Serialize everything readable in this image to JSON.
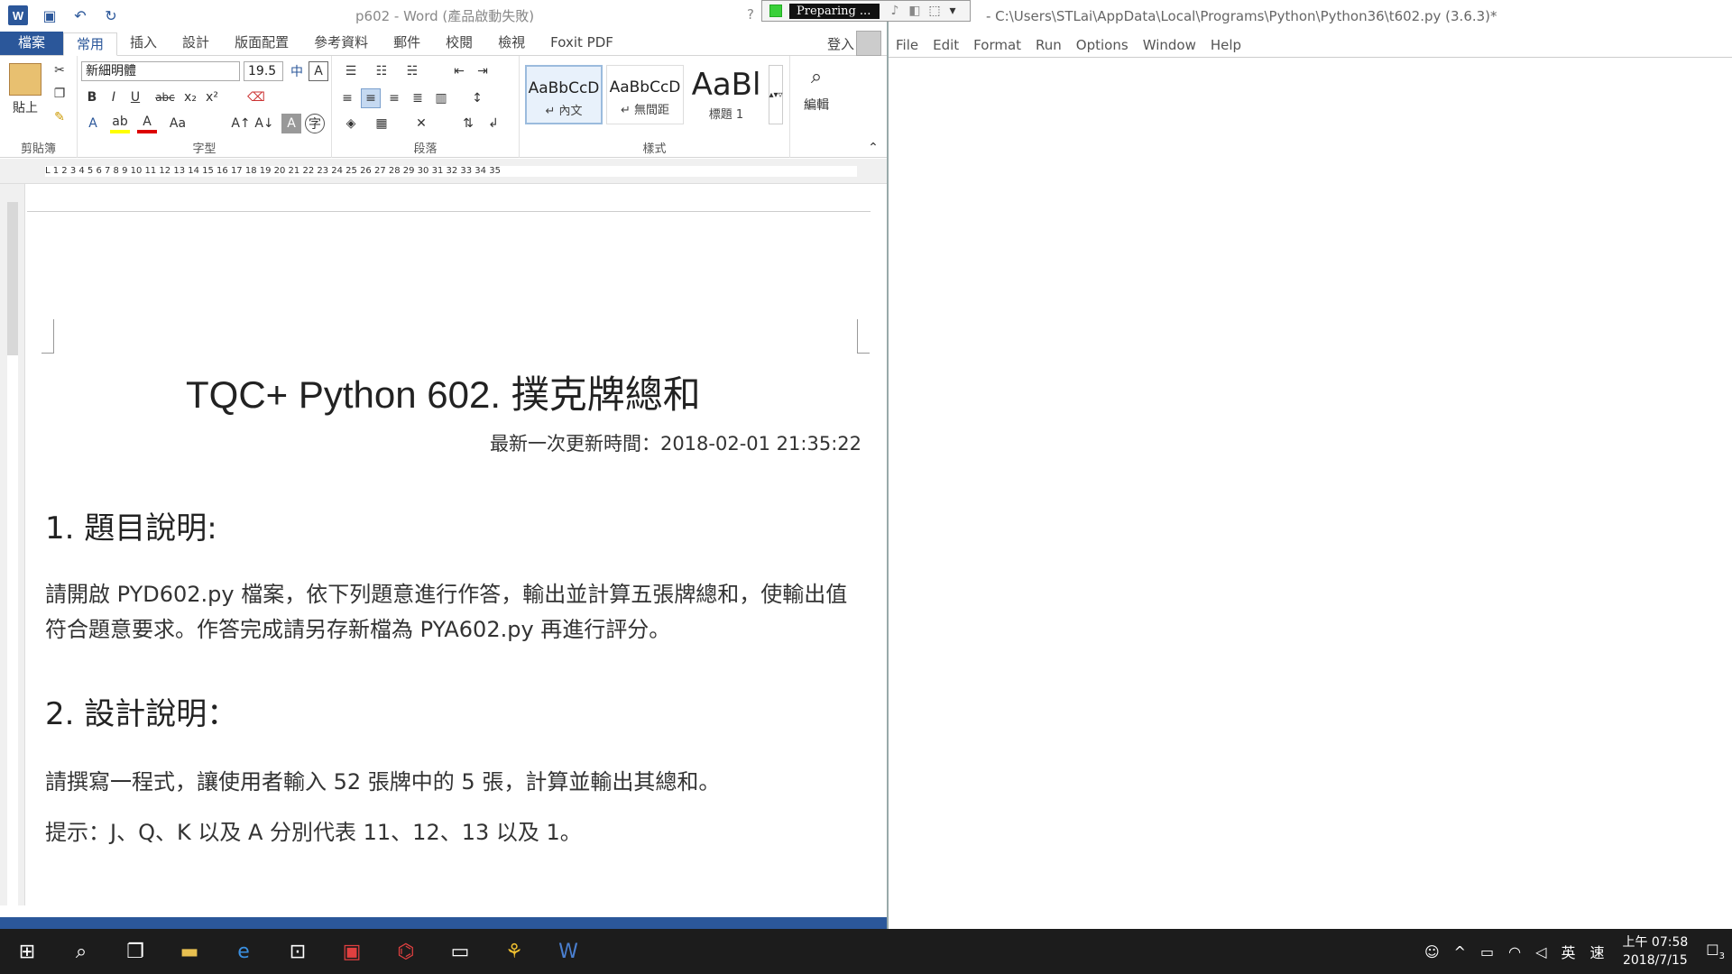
{
  "qat": {
    "title": "p602 - Word (產品啟動失敗)",
    "help": "?"
  },
  "tabs": [
    "檔案",
    "常用",
    "插入",
    "設計",
    "版面配置",
    "參考資料",
    "郵件",
    "校閱",
    "檢視",
    "Foxit PDF"
  ],
  "signin": "登入",
  "ribbon": {
    "clipboard": {
      "paste": "貼上",
      "label": "剪貼簿"
    },
    "font": {
      "name": "新細明體",
      "size": "19.5",
      "label": "字型",
      "bold": "B",
      "italic": "I",
      "underline": "U",
      "strike": "abc",
      "sub": "x₂",
      "sup": "x²",
      "case": "Aa"
    },
    "paragraph": {
      "label": "段落"
    },
    "styles": {
      "label": "樣式",
      "items": [
        {
          "preview": "AaBbCcD",
          "name": "↵ 內文"
        },
        {
          "preview": "AaBbCcD",
          "name": "↵ 無間距"
        },
        {
          "preview": "AaBl",
          "name": "標題 1"
        }
      ]
    },
    "editing": {
      "label": "編輯"
    }
  },
  "ruler": "L 1 2 3 4 5 6 7 8 9 10 11 12 13 14 15 16 17 18 19 20 21 22 23 24 25 26 27 28 29 30 31 32 33 34 35",
  "document": {
    "title": "TQC+ Python 602.  撲克牌總和",
    "date": "最新一次更新時間：2018-02-01 21:35:22",
    "h1": "1.  題目說明:",
    "p1": "請開啟 PYD602.py 檔案，依下列題意進行作答，輸出並計算五張牌總和，使輸出值符合題意要求。作答完成請另存新檔為 PYA602.py 再進行評分。",
    "h2": "2.  設計說明：",
    "p2": "請撰寫一程式，讓使用者輸入 52 張牌中的 5 張，計算並輸出其總和。",
    "p3": "提示：J、Q、K 以及 A 分別代表 11、12、13 以及 1。"
  },
  "idle": {
    "title": "- C:\\Users\\STLai\\AppData\\Local\\Programs\\Python\\Python36\\t602.py (3.6.3)*",
    "menu": [
      "File",
      "Edit",
      "Format",
      "Run",
      "Options",
      "Window",
      "Help"
    ]
  },
  "recorder": {
    "status": "Preparing ..."
  },
  "taskbar": {
    "time": "上午 07:58",
    "date": "2018/7/15",
    "lang": "英",
    "ime": "速",
    "notifications": "3"
  }
}
